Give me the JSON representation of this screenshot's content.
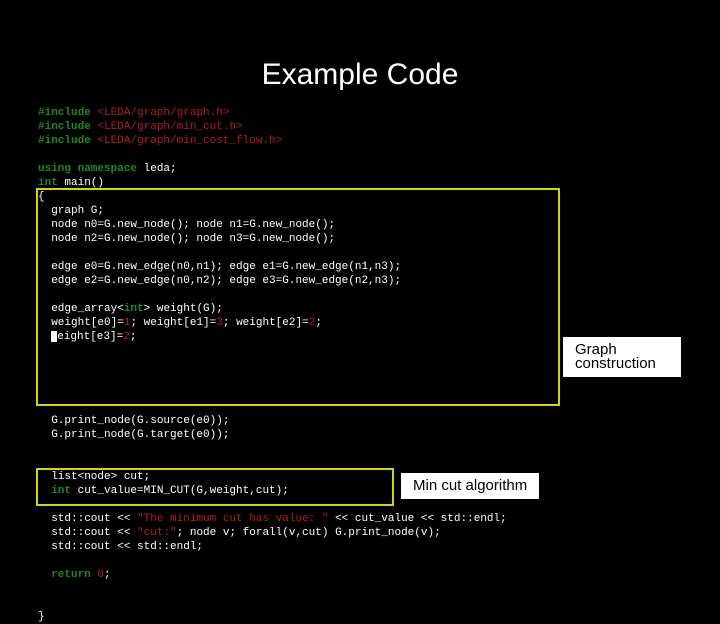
{
  "title": "Example Code",
  "labels": {
    "graph": "Graph construction",
    "mincut": "Min cut algorithm"
  },
  "code": {
    "l1a": "#include ",
    "l1b": "<LEDA/graph/graph.h>",
    "l2a": "#include ",
    "l2b": "<LEDA/graph/min_cut.h>",
    "l3a": "#include ",
    "l3b": "<LEDA/graph/min_cost_flow.h>",
    "l4a": "using namespace ",
    "l4b": "leda;",
    "l5a": "int ",
    "l5b": "main()",
    "l6": "{",
    "l7": "  graph G;",
    "l8": "  node n0=G.new_node(); node n1=G.new_node();",
    "l9": "  node n2=G.new_node(); node n3=G.new_node();",
    "l10": "  edge e0=G.new_edge(n0,n1); edge e1=G.new_edge(n1,n3);",
    "l11": "  edge e2=G.new_edge(n0,n2); edge e3=G.new_edge(n2,n3);",
    "l12a": "  edge_array<",
    "l12b": "int",
    "l12c": "> weight(G);",
    "l13a": "  weight[e0]=",
    "l13b": "1",
    "l13c": "; weight[e1]=",
    "l13d": "3",
    "l13e": "; weight[e2]=",
    "l13f": "2",
    "l13g": ";",
    "l14a": "  ",
    "l14b": "eight[e3]=",
    "l14c": "2",
    "l14d": ";",
    "l15": "  G.print_node(G.source(e0));",
    "l16": "  G.print_node(G.target(e0));",
    "l17": "  list<node> cut;",
    "l18a": "  int ",
    "l18b": "cut_value=MIN_CUT(G,weight,cut);",
    "l19a": "  std::cout << ",
    "l19b": "\"The minimum cut has value: \"",
    "l19c": " << cut_value << std::endl;",
    "l20a": "  std::cout << ",
    "l20b": "\"cut:\"",
    "l20c": "; node v; forall(v,cut) G.print_node(v);",
    "l21": "  std::cout << std::endl;",
    "l22a": "  return ",
    "l22b": "0",
    "l22c": ";",
    "l23": "}"
  }
}
